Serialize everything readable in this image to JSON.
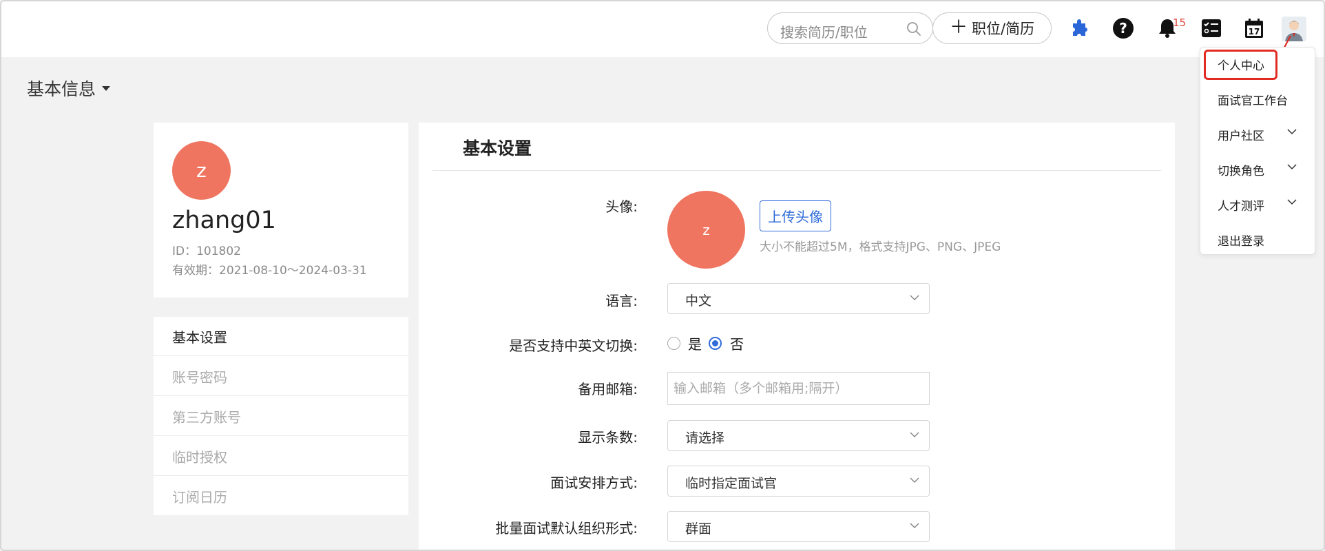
{
  "header": {
    "search_placeholder": "搜索简历/职位",
    "new_button_label": "职位/简历",
    "notification_count": "15",
    "icons": [
      "search-icon",
      "puzzle-icon",
      "help-icon",
      "bell-icon",
      "checklist-icon",
      "calendar-icon",
      "user-avatar-icon"
    ],
    "accent_color": "#2f6bd9"
  },
  "user_menu": {
    "items": [
      {
        "label": "个人中心",
        "highlighted": true
      },
      {
        "label": "面试官工作台"
      },
      {
        "label": "用户社区",
        "has_submenu": true
      },
      {
        "label": "切换角色",
        "has_submenu": true
      },
      {
        "label": "人才测评",
        "has_submenu": true
      },
      {
        "label": "退出登录"
      }
    ]
  },
  "page": {
    "title": "基本信息"
  },
  "profile": {
    "avatar_letter": "z",
    "username": "zhang01",
    "id_line": "ID：101802",
    "validity_line": "有效期：2021-08-10～2024-03-31",
    "avatar_color": "#f07560"
  },
  "sidemenu": {
    "items": [
      {
        "label": "基本设置",
        "active": true
      },
      {
        "label": "账号密码"
      },
      {
        "label": "第三方账号"
      },
      {
        "label": "临时授权"
      },
      {
        "label": "订阅日历"
      }
    ]
  },
  "settings": {
    "title": "基本设置",
    "avatar_label": "头像:",
    "avatar_letter": "z",
    "upload_label": "上传头像",
    "upload_hint": "大小不能超过5M，格式支持JPG、PNG、JPEG",
    "language_label": "语言:",
    "language_value": "中文",
    "bilingual_label": "是否支持中英文切换:",
    "bilingual_yes": "是",
    "bilingual_no": "否",
    "bilingual_selected": "否",
    "backup_email_label": "备用邮箱:",
    "backup_email_placeholder": "输入邮箱（多个邮箱用;隔开）",
    "backup_email_value": "",
    "page_size_label": "显示条数:",
    "page_size_value": "请选择",
    "interview_mode_label": "面试安排方式:",
    "interview_mode_value": "临时指定面试官",
    "batch_format_label": "批量面试默认组织形式:",
    "batch_format_value": "群面"
  }
}
